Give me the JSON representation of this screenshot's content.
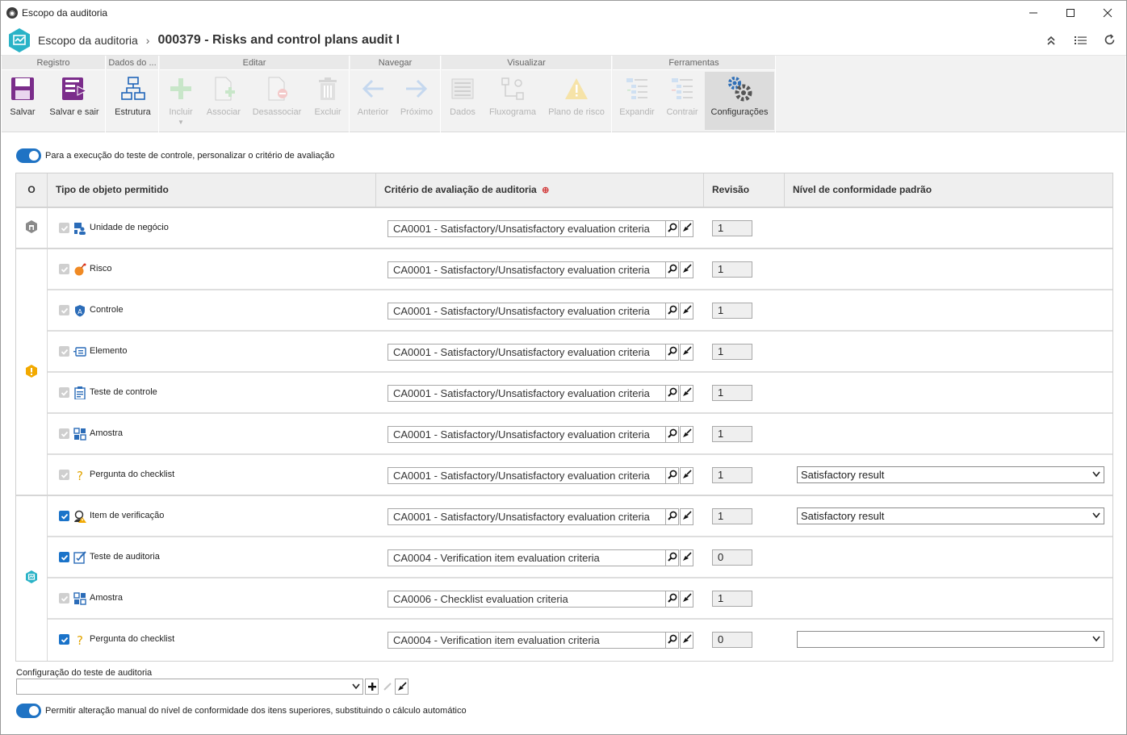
{
  "window": {
    "title": "Escopo da auditoria",
    "controls": [
      "minimize",
      "maximize",
      "close"
    ]
  },
  "header": {
    "breadcrumb_root": "Escopo da auditoria",
    "breadcrumb_current": "000379 - Risks and control plans audit I",
    "icons": [
      "collapse-up-icon",
      "list-icon",
      "refresh-icon"
    ]
  },
  "ribbon": {
    "groups": [
      {
        "title": "Registro",
        "buttons": [
          {
            "label": "Salvar",
            "enabled": true
          },
          {
            "label": "Salvar e sair",
            "enabled": true
          }
        ]
      },
      {
        "title": "Dados do ...",
        "buttons": [
          {
            "label": "Estrutura",
            "enabled": true
          }
        ]
      },
      {
        "title": "Editar",
        "buttons": [
          {
            "label": "Incluir",
            "enabled": false
          },
          {
            "label": "Associar",
            "enabled": false
          },
          {
            "label": "Desassociar",
            "enabled": false
          },
          {
            "label": "Excluir",
            "enabled": false
          }
        ]
      },
      {
        "title": "Navegar",
        "buttons": [
          {
            "label": "Anterior",
            "enabled": false
          },
          {
            "label": "Próximo",
            "enabled": false
          }
        ]
      },
      {
        "title": "Visualizar",
        "buttons": [
          {
            "label": "Dados",
            "enabled": false
          },
          {
            "label": "Fluxograma",
            "enabled": false
          },
          {
            "label": "Plano de risco",
            "enabled": false
          }
        ]
      },
      {
        "title": "Ferramentas",
        "buttons": [
          {
            "label": "Expandir",
            "enabled": false
          },
          {
            "label": "Contrair",
            "enabled": false
          },
          {
            "label": "Configurações",
            "enabled": true,
            "active": true
          }
        ]
      }
    ]
  },
  "toggle_top": {
    "label": "Para a execução do teste de controle, personalizar o critério de avaliação",
    "on": true
  },
  "table": {
    "headers": {
      "o": "O",
      "tipo": "Tipo de objeto permitido",
      "criterio": "Critério de avaliação de auditoria",
      "revisao": "Revisão",
      "nivel": "Nível de conformidade padrão"
    },
    "groups": [
      {
        "icon": "business-unit-group-icon",
        "rows": [
          {
            "checked": true,
            "enabled": false,
            "icon": "business-unit-icon",
            "type": "Unidade de negócio",
            "criteria": "CA0001 - Satisfactory/Unsatisfactory evaluation criteria",
            "revision": "1",
            "level": null
          }
        ]
      },
      {
        "icon": "risk-group-icon",
        "rows": [
          {
            "checked": true,
            "enabled": false,
            "icon": "risk-icon",
            "type": "Risco",
            "criteria": "CA0001 - Satisfactory/Unsatisfactory evaluation criteria",
            "revision": "1",
            "level": null
          },
          {
            "checked": true,
            "enabled": false,
            "icon": "control-icon",
            "type": "Controle",
            "criteria": "CA0001 - Satisfactory/Unsatisfactory evaluation criteria",
            "revision": "1",
            "level": null
          },
          {
            "checked": true,
            "enabled": false,
            "icon": "element-icon",
            "type": "Elemento",
            "criteria": "CA0001 - Satisfactory/Unsatisfactory evaluation criteria",
            "revision": "1",
            "level": null
          },
          {
            "checked": true,
            "enabled": false,
            "icon": "control-test-icon",
            "type": "Teste de controle",
            "criteria": "CA0001 - Satisfactory/Unsatisfactory evaluation criteria",
            "revision": "1",
            "level": null
          },
          {
            "checked": true,
            "enabled": false,
            "icon": "sample-icon",
            "type": "Amostra",
            "criteria": "CA0001 - Satisfactory/Unsatisfactory evaluation criteria",
            "revision": "1",
            "level": null
          },
          {
            "checked": true,
            "enabled": false,
            "icon": "question-icon",
            "type": "Pergunta do checklist",
            "criteria": "CA0001 - Satisfactory/Unsatisfactory evaluation criteria",
            "revision": "1",
            "level": "Satisfactory result"
          }
        ]
      },
      {
        "icon": "audit-group-icon",
        "rows": [
          {
            "checked": true,
            "enabled": true,
            "icon": "verification-item-icon",
            "type": "Item de verificação",
            "criteria": "CA0001 - Satisfactory/Unsatisfactory evaluation criteria",
            "revision": "1",
            "level": "Satisfactory result"
          },
          {
            "checked": true,
            "enabled": true,
            "icon": "audit-test-icon",
            "type": "Teste de auditoria",
            "criteria": "CA0004 - Verification item evaluation criteria",
            "revision": "0",
            "level": null
          },
          {
            "checked": true,
            "enabled": false,
            "icon": "sample-icon",
            "type": "Amostra",
            "criteria": "CA0006 - Checklist evaluation criteria",
            "revision": "1",
            "level": null
          },
          {
            "checked": true,
            "enabled": true,
            "icon": "question-icon",
            "type": "Pergunta do checklist",
            "criteria": "CA0004 - Verification item evaluation criteria",
            "revision": "0",
            "level": ""
          }
        ]
      }
    ]
  },
  "footer": {
    "config_label": "Configuração do teste de auditoria",
    "config_value": "",
    "toggle_bottom": {
      "label": "Permitir alteração manual do nível de conformidade dos itens superiores, substituindo o cálculo automático",
      "on": true
    }
  }
}
